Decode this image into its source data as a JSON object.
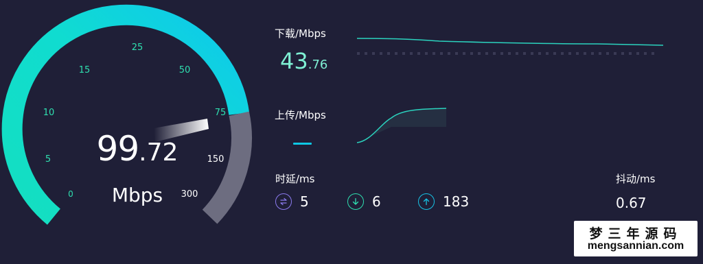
{
  "gauge": {
    "value_int": "99",
    "value_dec": ".72",
    "unit": "Mbps",
    "ticks": [
      "0",
      "5",
      "10",
      "15",
      "25",
      "50",
      "75",
      "150",
      "300"
    ],
    "colors": {
      "arc_teal": "#18e0c4",
      "arc_cyan": "#0ed0ee",
      "arc_gray": "#6d6d80",
      "needle": "#ffffff",
      "tick_green": "#2fe0b0"
    }
  },
  "download": {
    "label": "下载/Mbps",
    "value_int": "43",
    "value_dec": ".76",
    "color": "#7ff0d4"
  },
  "upload": {
    "label": "上传/Mbps",
    "color": "#2bd4bf"
  },
  "latency": {
    "label": "时延/ms",
    "items": [
      {
        "icon": "swap-icon",
        "value": "5",
        "color": "#8c7bf0"
      },
      {
        "icon": "arrow-down-circle-icon",
        "value": "6",
        "color": "#2fe0b0"
      },
      {
        "icon": "arrow-up-circle-icon",
        "value": "183",
        "color": "#17c4e6"
      }
    ]
  },
  "jitter": {
    "label": "抖动/ms",
    "value": "0.67"
  },
  "watermark": {
    "chinese": "梦三年源码",
    "site": "mengsannian.com"
  }
}
